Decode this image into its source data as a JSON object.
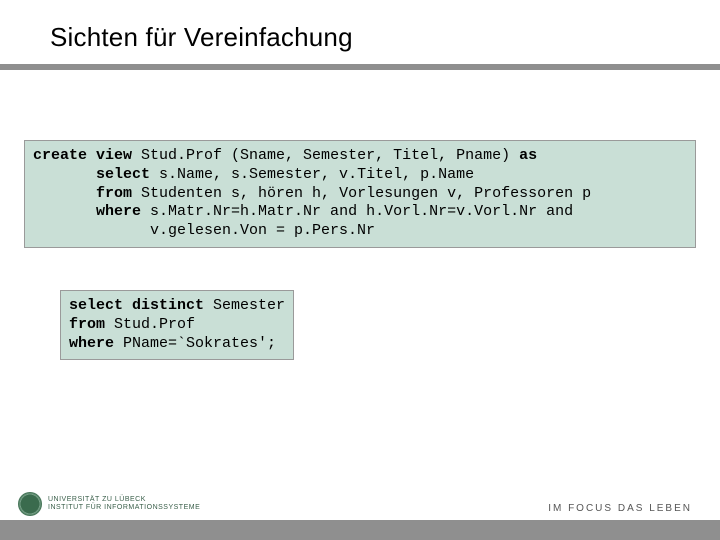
{
  "title": "Sichten für Vereinfachung",
  "code1": {
    "l1a": "create view",
    "l1b": " Stud.Prof (Sname, Semester, Titel, Pname) ",
    "l1c": "as",
    "l2a": "       select",
    "l2b": " s.Name, s.Semester, v.Titel, p.Name",
    "l3a": "       from",
    "l3b": " Studenten s, hören h, Vorlesungen v, Professoren p",
    "l4a": "       where",
    "l4b": " s.Matr.Nr=h.Matr.Nr and h.Vorl.Nr=v.Vorl.Nr and",
    "l5": "             v.gelesen.Von = p.Pers.Nr"
  },
  "code2": {
    "l1a": "select distinct",
    "l1b": " Semester",
    "l2a": "from",
    "l2b": " Stud.Prof",
    "l3a": "where",
    "l3b": " PName=`Sokrates';"
  },
  "footer": {
    "uni_line1": "UNIVERSITÄT ZU LÜBECK",
    "uni_line2": "INSTITUT FÜR INFORMATIONSSYSTEME",
    "right": "IM FOCUS DAS LEBEN"
  }
}
